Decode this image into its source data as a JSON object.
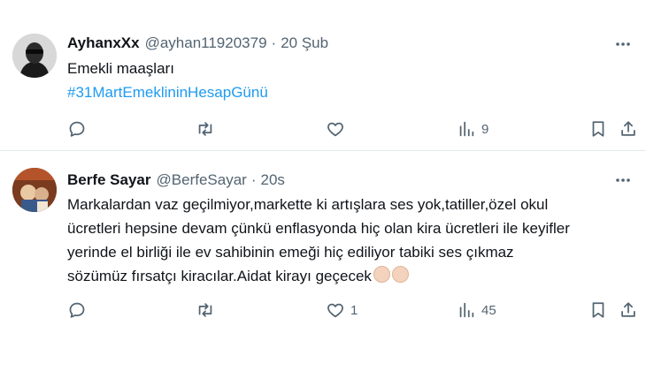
{
  "posts": [
    {
      "author": {
        "display_name": "AyhanxXx",
        "handle": "@ayhan11920379",
        "avatar_icon": "user-avatar"
      },
      "separator": "·",
      "time": "20 Şub",
      "lines": [
        "Emekli maaşları"
      ],
      "hashtag": "#31MartEmeklininHesapGünü",
      "actions": {
        "reply_count": "",
        "repost_count": "",
        "like_count": "",
        "views_count": "9"
      }
    },
    {
      "author": {
        "display_name": "Berfe Sayar",
        "handle": "@BerfeSayar",
        "avatar_icon": "user-avatar"
      },
      "separator": "·",
      "time": "20s",
      "lines": [
        "Markalardan vaz geçilmiyor,markette ki artışlara ses yok,tatiller,özel okul",
        "ücretleri hepsine devam çünkü enflasyonda hiç olan kira ücretleri ile keyifler",
        "yerinde el birliği ile ev sahibinin emeği hiç ediliyor tabiki ses çıkmaz",
        "sözümüz fırsatçı kiracılar.Aidat kirayı geçecek"
      ],
      "emoji": [
        "clapping-hands-icon",
        "clapping-hands-icon"
      ],
      "actions": {
        "reply_count": "",
        "repost_count": "",
        "like_count": "1",
        "views_count": "45"
      }
    }
  ],
  "colors": {
    "text": "#0f1419",
    "muted": "#536471",
    "link": "#1d9bf0",
    "divider": "#e6e9ec"
  }
}
